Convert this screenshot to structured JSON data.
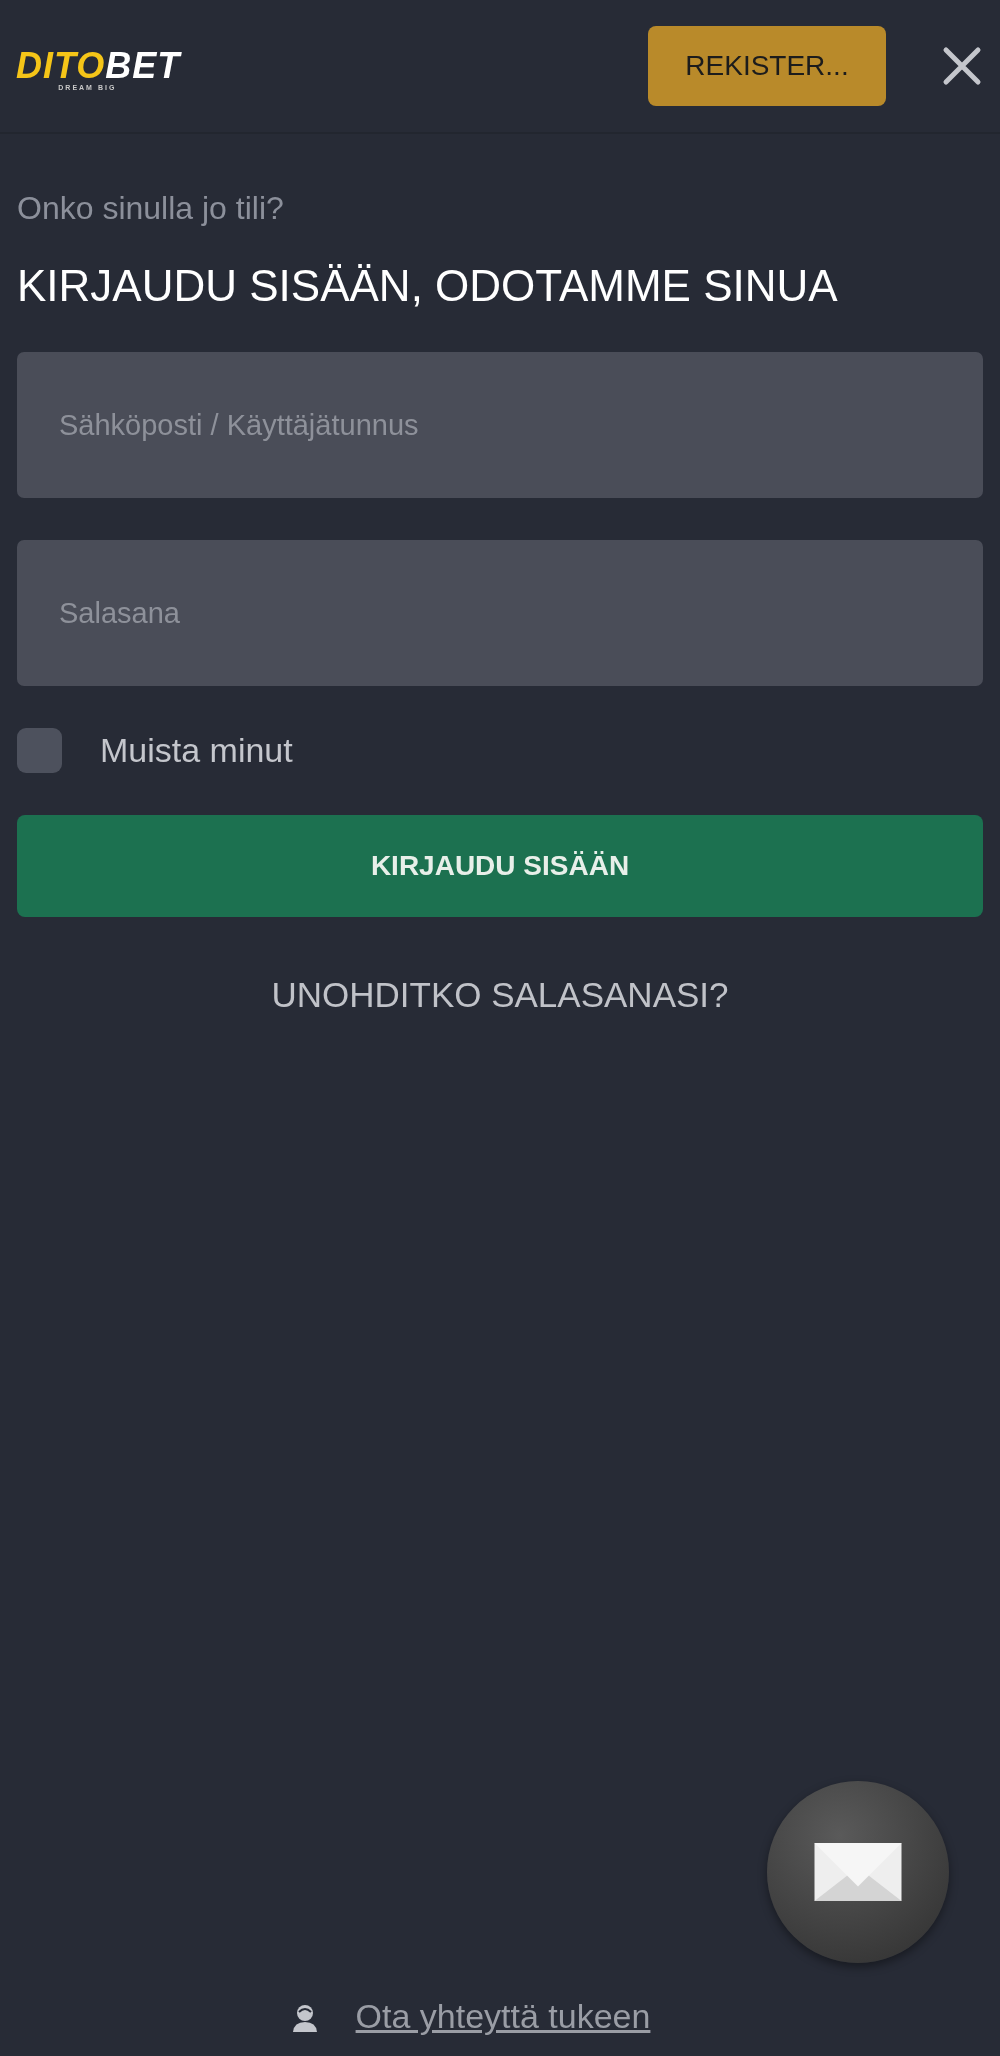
{
  "header": {
    "logo": {
      "part_1": "DITO",
      "part_2": "BET",
      "tagline": "DREAM BIG"
    },
    "register_button": "REKISTER..."
  },
  "login": {
    "question": "Onko sinulla jo tili?",
    "heading": "KIRJAUDU SISÄÄN, ODOTAMME SINUA",
    "fields": [
      {
        "placeholder": "Sähköposti / Käyttäjätunnus"
      },
      {
        "placeholder": "Salasana"
      }
    ],
    "remember": {
      "label": "Muista minut",
      "checked": false
    },
    "submit_button": "KIRJAUDU SISÄÄN",
    "forgot_link": "UNOHDITKO SALASANASI?"
  },
  "support_link": "Ota yhteyttä tukeen"
}
